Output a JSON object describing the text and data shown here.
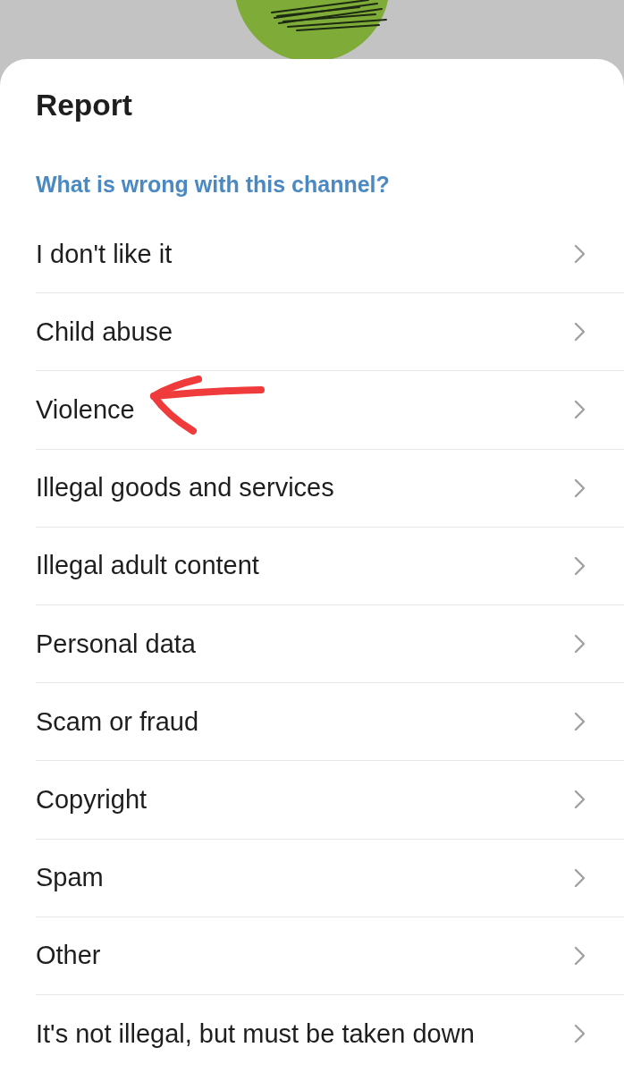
{
  "sheet": {
    "title": "Report",
    "subtitle": "What is wrong with this channel?"
  },
  "reasons": [
    {
      "label": "I don't like it",
      "annotated": false
    },
    {
      "label": "Child abuse",
      "annotated": false
    },
    {
      "label": "Violence",
      "annotated": true
    },
    {
      "label": "Illegal goods and services",
      "annotated": false
    },
    {
      "label": "Illegal adult content",
      "annotated": false
    },
    {
      "label": "Personal data",
      "annotated": false
    },
    {
      "label": "Scam or fraud",
      "annotated": false
    },
    {
      "label": "Copyright",
      "annotated": false
    },
    {
      "label": "Spam",
      "annotated": false
    },
    {
      "label": "Other",
      "annotated": false
    },
    {
      "label": "It's not illegal, but must be taken down",
      "annotated": false
    }
  ]
}
